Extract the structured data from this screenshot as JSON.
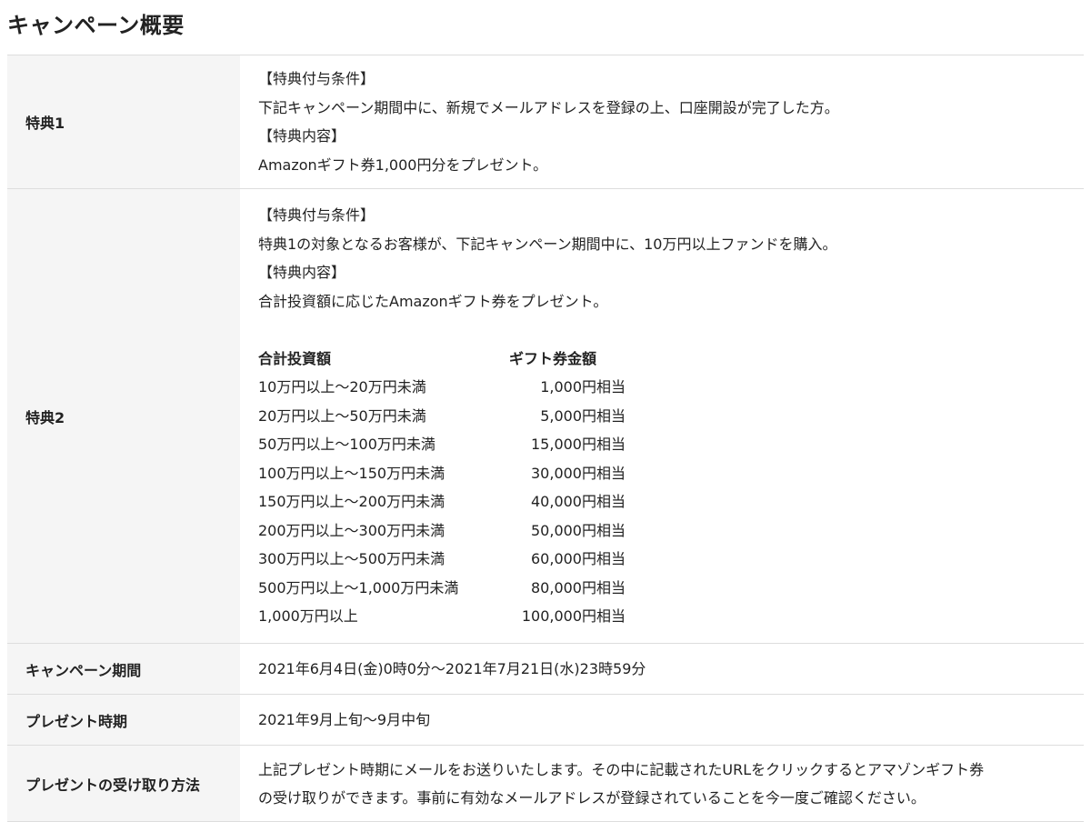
{
  "page": {
    "title": "キャンペーン概要"
  },
  "tokuten1": {
    "label": "特典1",
    "lines": [
      "【特典付与条件】",
      "下記キャンペーン期間中に、新規でメールアドレスを登録の上、口座開設が完了した方。",
      "【特典内容】",
      "Amazonギフト券1,000円分をプレゼント。"
    ]
  },
  "tokuten2": {
    "label": "特典2",
    "lines": [
      "【特典付与条件】",
      "特典1の対象となるお客様が、下記キャンペーン期間中に、10万円以上ファンドを購入。",
      "【特典内容】",
      "合計投資額に応じたAmazonギフト券をプレゼント。"
    ],
    "gift_table": {
      "headers": [
        "合計投資額",
        "ギフト券金額"
      ],
      "rows": [
        [
          "10万円以上〜20万円未満",
          "1,000円相当"
        ],
        [
          "20万円以上〜50万円未満",
          "5,000円相当"
        ],
        [
          "50万円以上〜100万円未満",
          "15,000円相当"
        ],
        [
          "100万円以上〜150万円未満",
          "30,000円相当"
        ],
        [
          "150万円以上〜200万円未満",
          "40,000円相当"
        ],
        [
          "200万円以上〜300万円未満",
          "50,000円相当"
        ],
        [
          "300万円以上〜500万円未満",
          "60,000円相当"
        ],
        [
          "500万円以上〜1,000万円未満",
          "80,000円相当"
        ],
        [
          "1,000万円以上",
          "100,000円相当"
        ]
      ]
    }
  },
  "period": {
    "label": "キャンペーン期間",
    "value": "2021年6月4日(金)0時0分〜2021年7月21日(水)23時59分"
  },
  "present": {
    "label": "プレゼント時期",
    "value": "2021年9月上旬〜9月中旬"
  },
  "receive": {
    "label": "プレゼントの受け取り方法",
    "lines": [
      "上記プレゼント時期にメールをお送りいたします。その中に記載されたURLをクリックするとアマゾンギフト券",
      "の受け取りができます。事前に有効なメールアドレスが登録されていることを今一度ご確認ください。"
    ]
  }
}
